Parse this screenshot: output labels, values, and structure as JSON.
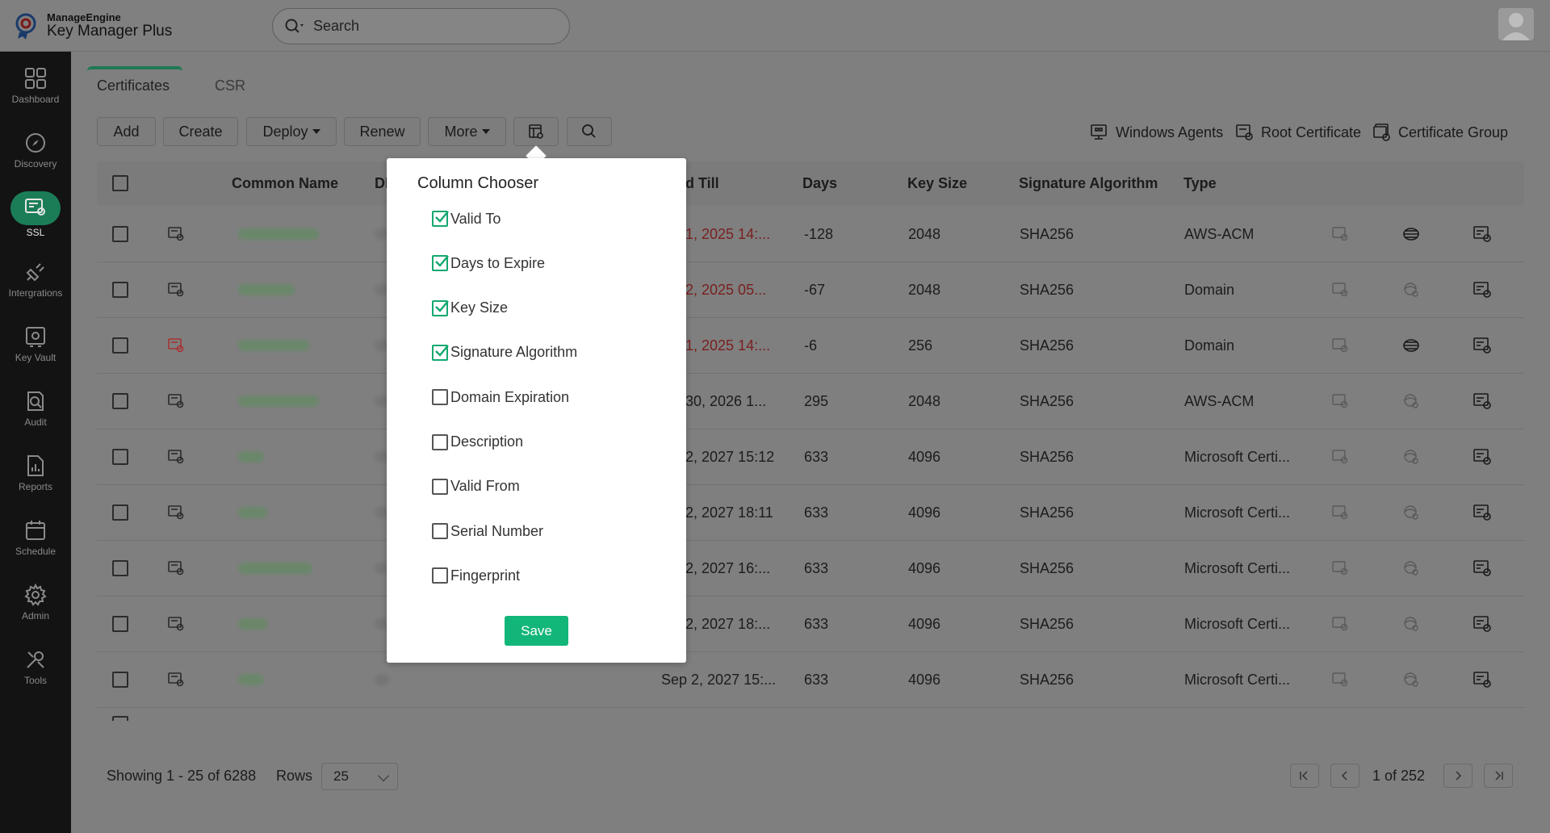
{
  "app": {
    "brand_top": "ManageEngine",
    "brand_bottom": "Key Manager Plus",
    "search_placeholder": "Search"
  },
  "sidebar": {
    "items": [
      {
        "label": "Dashboard",
        "icon": "dashboard-icon"
      },
      {
        "label": "Discovery",
        "icon": "compass-icon"
      },
      {
        "label": "SSL",
        "icon": "certificate-icon",
        "active": true
      },
      {
        "label": "Intergrations",
        "icon": "plug-icon"
      },
      {
        "label": "Key Vault",
        "icon": "vault-icon"
      },
      {
        "label": "Audit",
        "icon": "audit-search-icon"
      },
      {
        "label": "Reports",
        "icon": "reports-icon"
      },
      {
        "label": "Schedule",
        "icon": "calendar-icon"
      },
      {
        "label": "Admin",
        "icon": "gear-icon"
      },
      {
        "label": "Tools",
        "icon": "tools-icon"
      }
    ]
  },
  "tabs": {
    "certificates": "Certificates",
    "csr": "CSR"
  },
  "toolbar": {
    "add": "Add",
    "create": "Create",
    "deploy": "Deploy",
    "renew": "Renew",
    "more": "More",
    "windows_agents": "Windows Agents",
    "root_certificate": "Root Certificate",
    "certificate_group": "Certificate Group"
  },
  "table": {
    "headers": {
      "common_name": "Common Name",
      "dns": "DI",
      "valid_till": "d Till",
      "days": "Days",
      "key_size": "Key Size",
      "sig_alg": "Signature Algorithm",
      "type": "Type"
    },
    "rows": [
      {
        "valid": "1, 2025 14:...",
        "expired": true,
        "days": "-128",
        "key": "2048",
        "sig": "SHA256",
        "type": "AWS-ACM",
        "status": "normal",
        "middle": "network-icon"
      },
      {
        "valid": "2, 2025 05...",
        "expired": true,
        "days": "-67",
        "key": "2048",
        "sig": "SHA256",
        "type": "Domain",
        "status": "normal",
        "middle": "globe-icon"
      },
      {
        "valid": "1, 2025 14:...",
        "expired": true,
        "days": "-6",
        "key": "256",
        "sig": "SHA256",
        "type": "Domain",
        "status": "alert",
        "middle": "network-icon"
      },
      {
        "valid": "30, 2026 1...",
        "expired": false,
        "days": "295",
        "key": "2048",
        "sig": "SHA256",
        "type": "AWS-ACM",
        "status": "normal",
        "middle": "globe-icon"
      },
      {
        "valid": "2, 2027 15:12",
        "expired": false,
        "days": "633",
        "key": "4096",
        "sig": "SHA256",
        "type": "Microsoft Certi...",
        "status": "normal",
        "middle": "globe-icon"
      },
      {
        "valid": "2, 2027 18:11",
        "expired": false,
        "days": "633",
        "key": "4096",
        "sig": "SHA256",
        "type": "Microsoft Certi...",
        "status": "normal",
        "middle": "globe-icon"
      },
      {
        "valid": "2, 2027 16:...",
        "expired": false,
        "days": "633",
        "key": "4096",
        "sig": "SHA256",
        "type": "Microsoft Certi...",
        "status": "normal",
        "middle": "globe-icon"
      },
      {
        "valid": "2, 2027 18:...",
        "expired": false,
        "days": "633",
        "key": "4096",
        "sig": "SHA256",
        "type": "Microsoft Certi...",
        "status": "normal",
        "middle": "globe-icon"
      },
      {
        "valid": "Sep 2, 2027 15:...",
        "expired": false,
        "days": "633",
        "key": "4096",
        "sig": "SHA256",
        "type": "Microsoft Certi...",
        "status": "normal",
        "middle": "globe-icon"
      }
    ]
  },
  "footer": {
    "showing": "Showing 1 - 25 of 6288",
    "rows_label": "Rows",
    "rows_value": "25",
    "page": "1 of 252"
  },
  "column_chooser": {
    "title": "Column Chooser",
    "options": [
      {
        "label": "Valid To",
        "checked": true
      },
      {
        "label": "Days to Expire",
        "checked": true
      },
      {
        "label": "Key Size",
        "checked": true
      },
      {
        "label": "Signature Algorithm",
        "checked": true
      },
      {
        "label": "Domain Expiration",
        "checked": false
      },
      {
        "label": "Description",
        "checked": false
      },
      {
        "label": "Valid From",
        "checked": false
      },
      {
        "label": "Serial Number",
        "checked": false
      },
      {
        "label": "Fingerprint",
        "checked": false
      }
    ],
    "save": "Save"
  },
  "colors": {
    "accent": "#13b679",
    "sidebar_bg": "#131313",
    "active_nav": "#1b7d57",
    "expired_text": "#7a2020"
  }
}
